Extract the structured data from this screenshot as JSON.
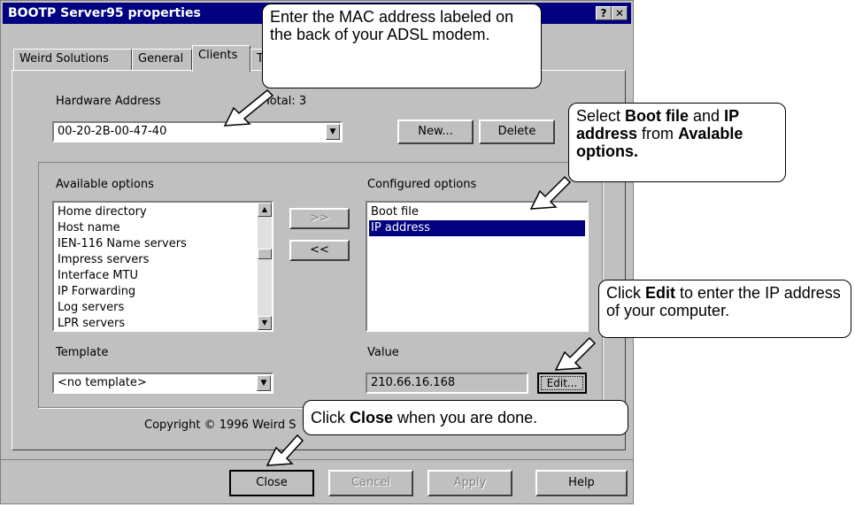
{
  "window": {
    "title": "BOOTP Server95 properties",
    "help_button": "?",
    "close_button": "✕"
  },
  "tabs": [
    "Weird Solutions",
    "General",
    "Clients",
    "T"
  ],
  "hardware": {
    "label": "Hardware Address",
    "total_label": "Total:",
    "total_value": "3",
    "value": "00-20-2B-00-47-40",
    "new_button": "New...",
    "delete_button": "Delete"
  },
  "available": {
    "label": "Available options",
    "items": [
      "Home directory",
      "Host name",
      "IEN-116 Name servers",
      "Impress servers",
      "Interface MTU",
      "IP Forwarding",
      "Log servers",
      "LPR servers"
    ]
  },
  "move": {
    "add": ">>",
    "remove": "<<"
  },
  "configured": {
    "label": "Configured options",
    "items": [
      "Boot file",
      "IP address"
    ],
    "selected_index": 1
  },
  "template": {
    "label": "Template",
    "value": "<no template>"
  },
  "value_field": {
    "label": "Value",
    "value": "210.66.16.168",
    "edit_button": "Edit..."
  },
  "copyright": "Copyright © 1996 Weird S",
  "footer": {
    "close": "Close",
    "cancel": "Cancel",
    "apply": "Apply",
    "help": "Help"
  },
  "callouts": {
    "mac": "Enter the MAC address labeled on the back of your ADSL modem.",
    "select_pre": "Select ",
    "select_bold1": "Boot file",
    "select_mid1": " and ",
    "select_bold2": "IP address",
    "select_mid2": " from ",
    "select_bold3": "Avalable options.",
    "edit_pre": "Click ",
    "edit_bold": "Edit",
    "edit_post": " to enter the IP address of your computer.",
    "close_pre": "Click ",
    "close_bold": "Close",
    "close_post": " when you are done."
  },
  "colors": {
    "titlebar": "#000080",
    "dialog": "#c0c0c0",
    "selection": "#000080"
  }
}
